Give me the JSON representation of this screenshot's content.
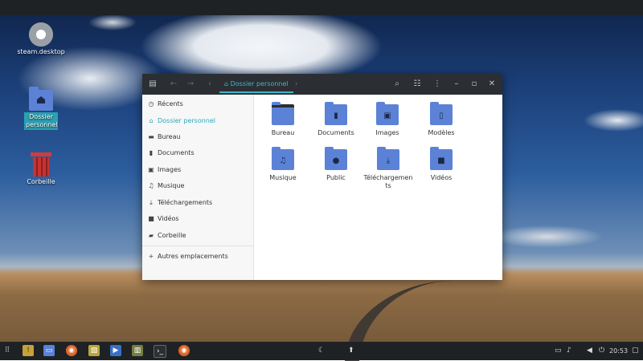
{
  "desktop": {
    "icons": [
      {
        "label": "steam.desktop",
        "icon": "gear-icon"
      },
      {
        "label": "Dossier personnel",
        "icon": "home-folder-icon"
      },
      {
        "label": "Corbeille",
        "icon": "trash-icon"
      }
    ]
  },
  "window": {
    "breadcrumb": "Dossier personnel",
    "sidebar": [
      {
        "label": "Récents",
        "icon": "clock-icon"
      },
      {
        "label": "Dossier personnel",
        "icon": "home-icon",
        "active": true
      },
      {
        "label": "Bureau",
        "icon": "desktop-icon"
      },
      {
        "label": "Documents",
        "icon": "document-icon"
      },
      {
        "label": "Images",
        "icon": "image-icon"
      },
      {
        "label": "Musique",
        "icon": "music-icon"
      },
      {
        "label": "Téléchargements",
        "icon": "download-icon"
      },
      {
        "label": "Vidéos",
        "icon": "video-icon"
      },
      {
        "label": "Corbeille",
        "icon": "trash-icon"
      },
      {
        "label": "Autres emplacements",
        "icon": "plus-icon"
      }
    ],
    "folders": [
      {
        "label": "Bureau",
        "icon": "desktop-folder-icon"
      },
      {
        "label": "Documents",
        "icon": "documents-folder-icon"
      },
      {
        "label": "Images",
        "icon": "images-folder-icon"
      },
      {
        "label": "Modèles",
        "icon": "templates-folder-icon"
      },
      {
        "label": "Musique",
        "icon": "music-folder-icon"
      },
      {
        "label": "Public",
        "icon": "public-folder-icon"
      },
      {
        "label": "Téléchargements",
        "icon": "downloads-folder-icon"
      },
      {
        "label": "Vidéos",
        "icon": "videos-folder-icon"
      }
    ]
  },
  "taskbar": {
    "clock": "20:53"
  },
  "colors": {
    "accent": "#2aa8bc",
    "folder": "#5b82d6",
    "titlebar": "#2b2f33",
    "panel": "#1f2224"
  }
}
